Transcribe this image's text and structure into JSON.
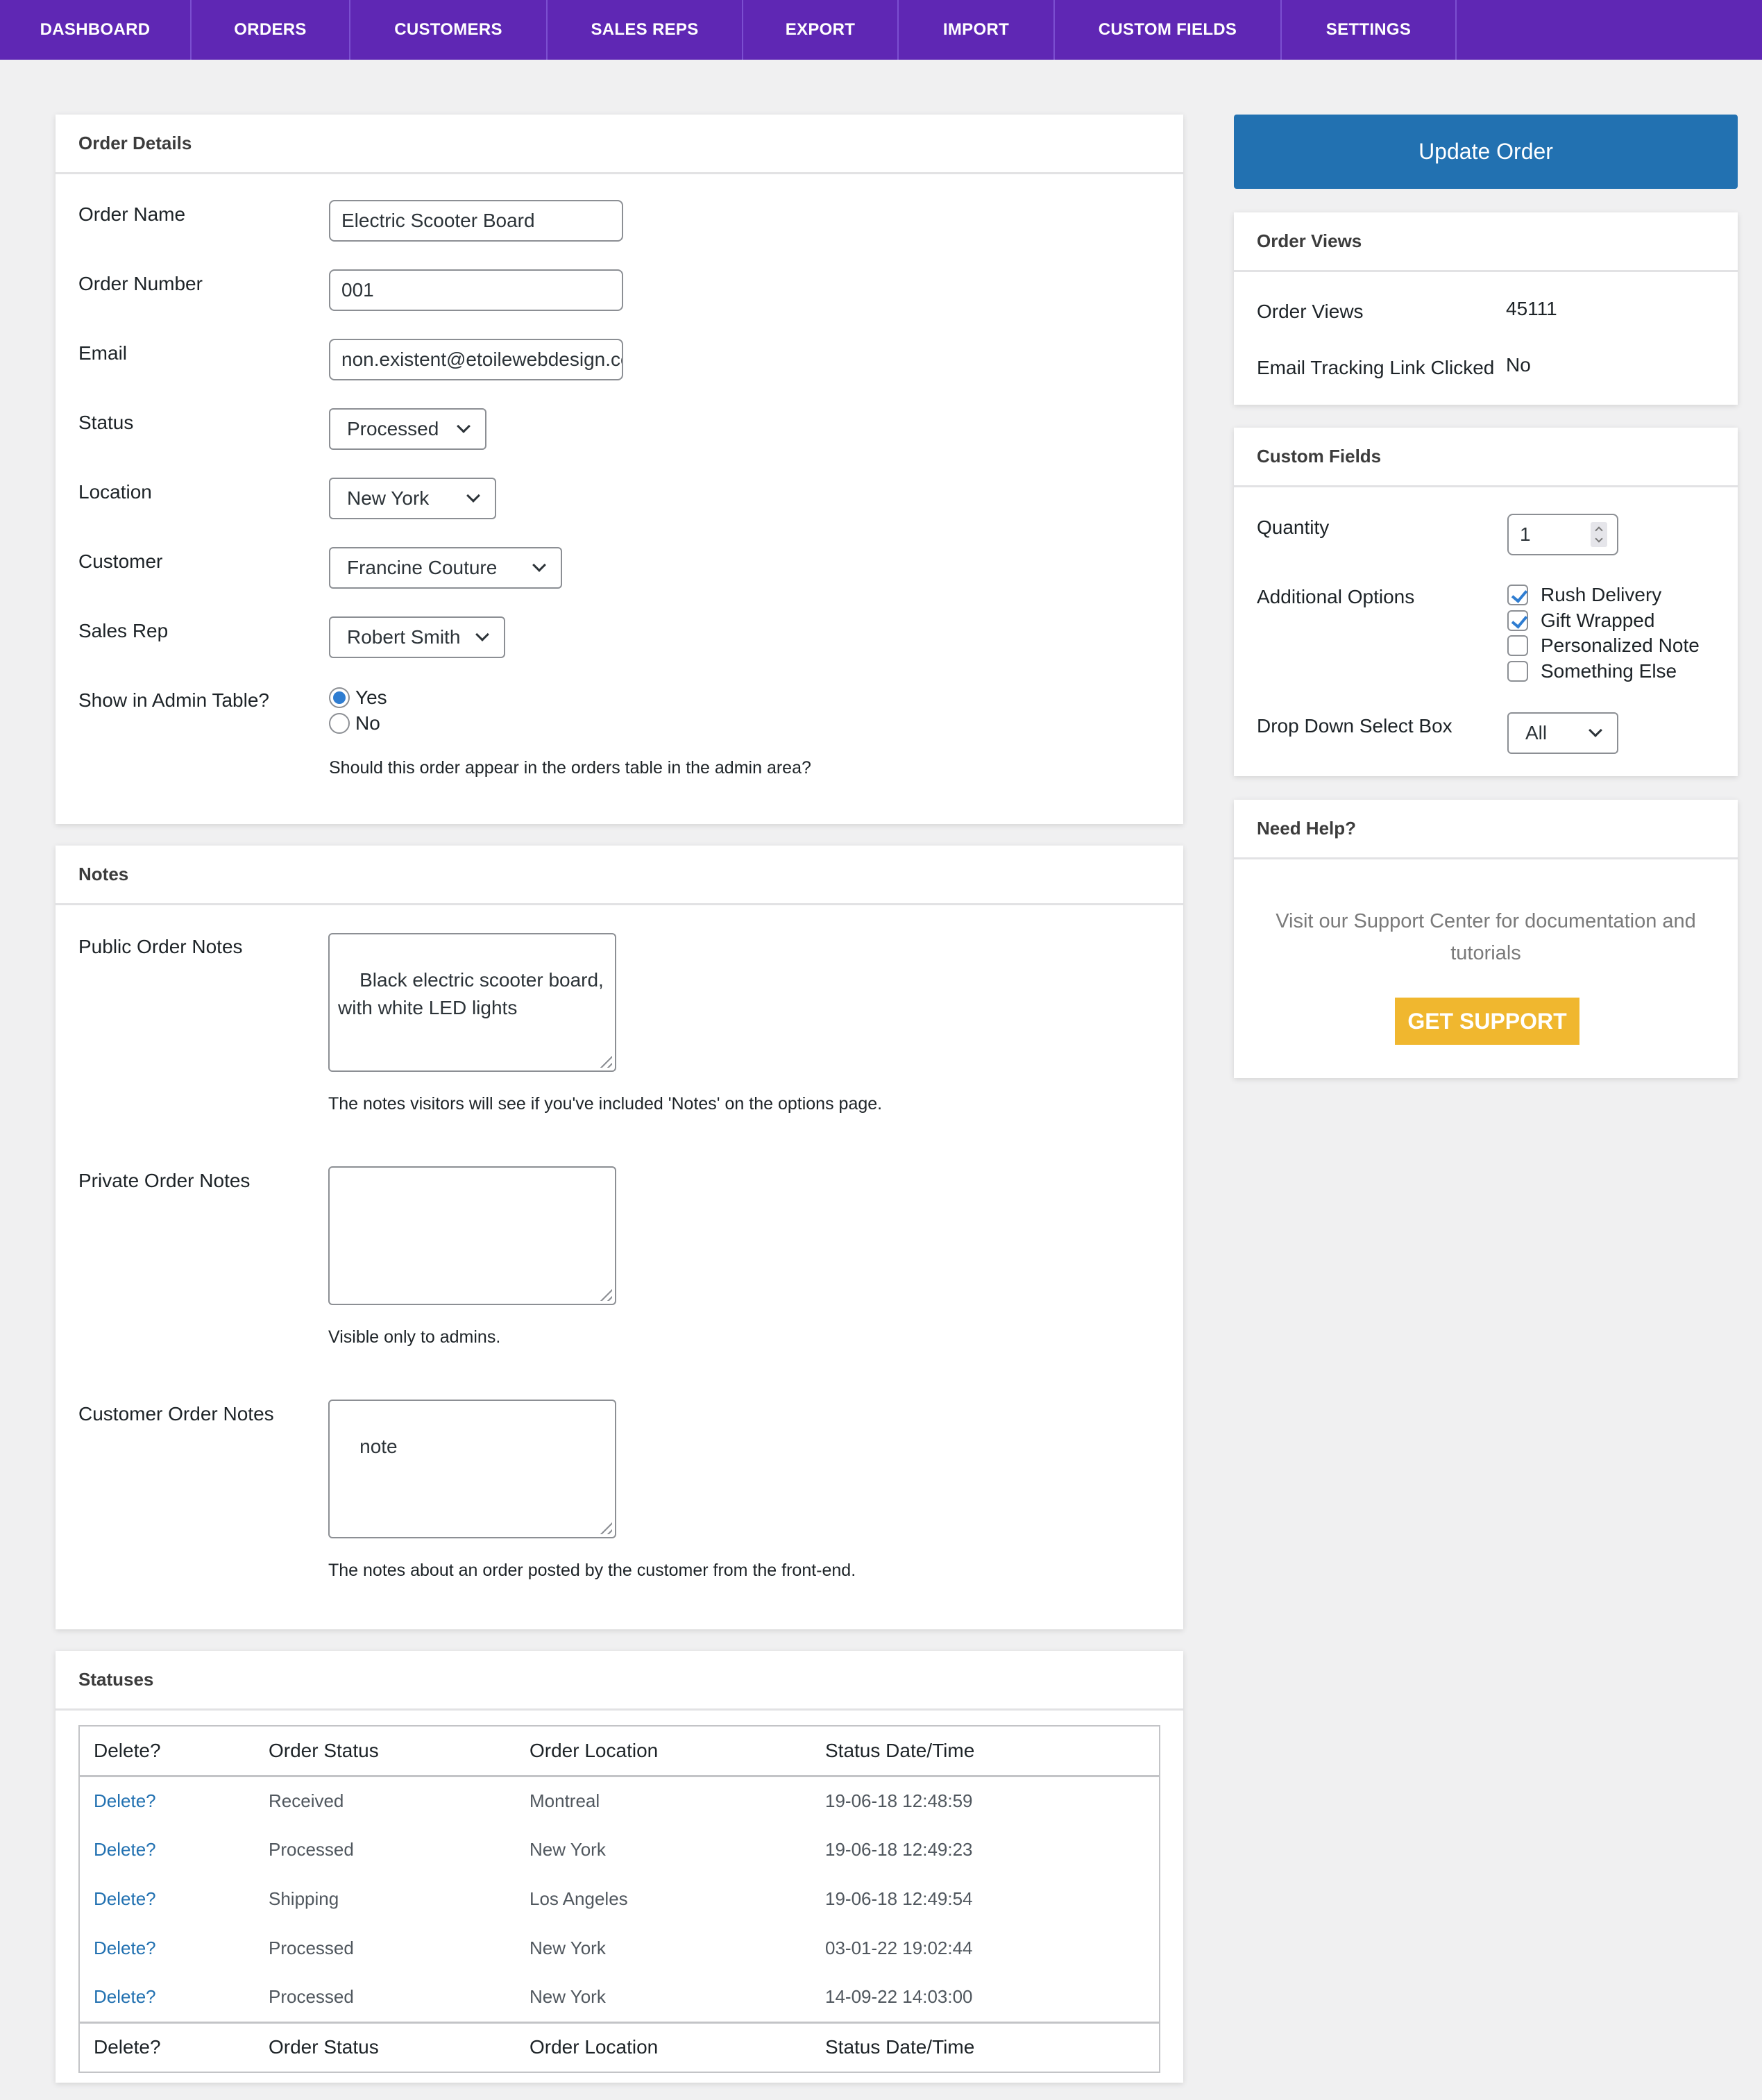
{
  "nav": {
    "items": [
      {
        "label": "DASHBOARD"
      },
      {
        "label": "ORDERS"
      },
      {
        "label": "CUSTOMERS"
      },
      {
        "label": "SALES REPS"
      },
      {
        "label": "EXPORT"
      },
      {
        "label": "IMPORT"
      },
      {
        "label": "CUSTOM FIELDS"
      },
      {
        "label": "SETTINGS"
      }
    ]
  },
  "order_details": {
    "title": "Order Details",
    "order_name": {
      "label": "Order Name",
      "value": "Electric Scooter Board"
    },
    "order_number": {
      "label": "Order Number",
      "value": "001"
    },
    "email": {
      "label": "Email",
      "value": "non.existent@etoilewebdesign.com"
    },
    "status": {
      "label": "Status",
      "value": "Processed"
    },
    "location": {
      "label": "Location",
      "value": "New York"
    },
    "customer": {
      "label": "Customer",
      "value": "Francine Couture"
    },
    "sales_rep": {
      "label": "Sales Rep",
      "value": "Robert Smith"
    },
    "show_in_admin": {
      "label": "Show in Admin Table?",
      "options": [
        {
          "label": "Yes",
          "checked": true
        },
        {
          "label": "No",
          "checked": false
        }
      ],
      "description": "Should this order appear in the orders table in the admin area?"
    }
  },
  "notes": {
    "title": "Notes",
    "public": {
      "label": "Public Order Notes",
      "value": "Black electric scooter board,\nwith white LED lights",
      "description": "The notes visitors will see if you've included 'Notes' on the options page."
    },
    "private": {
      "label": "Private Order Notes",
      "value": "",
      "description": "Visible only to admins."
    },
    "customer": {
      "label": "Customer Order Notes",
      "value": "note",
      "description": "The notes about an order posted by the customer from the front-end."
    }
  },
  "statuses": {
    "title": "Statuses",
    "columns": [
      "Delete?",
      "Order Status",
      "Order Location",
      "Status Date/Time"
    ],
    "rows": [
      {
        "delete": "Delete?",
        "status": "Received",
        "location": "Montreal",
        "datetime": "19-06-18 12:48:59"
      },
      {
        "delete": "Delete?",
        "status": "Processed",
        "location": "New York",
        "datetime": "19-06-18 12:49:23"
      },
      {
        "delete": "Delete?",
        "status": "Shipping",
        "location": "Los Angeles",
        "datetime": "19-06-18 12:49:54"
      },
      {
        "delete": "Delete?",
        "status": "Processed",
        "location": "New York",
        "datetime": "03-01-22 19:02:44"
      },
      {
        "delete": "Delete?",
        "status": "Processed",
        "location": "New York",
        "datetime": "14-09-22 14:03:00"
      }
    ]
  },
  "sidebar": {
    "update_button": "Update Order",
    "order_views": {
      "title": "Order Views",
      "views_label": "Order Views",
      "views_value": "45111",
      "tracking_label": "Email Tracking Link Clicked",
      "tracking_value": "No"
    },
    "custom_fields": {
      "title": "Custom Fields",
      "quantity_label": "Quantity",
      "quantity_value": "1",
      "options_label": "Additional Options",
      "options": [
        {
          "label": "Rush Delivery",
          "checked": true
        },
        {
          "label": "Gift Wrapped",
          "checked": true
        },
        {
          "label": "Personalized Note",
          "checked": false
        },
        {
          "label": "Something Else",
          "checked": false
        }
      ],
      "dropdown_label": "Drop Down Select Box",
      "dropdown_value": "All"
    },
    "help": {
      "title": "Need Help?",
      "text": "Visit our Support Center for documentation and tutorials",
      "button": "GET SUPPORT"
    }
  },
  "colors": {
    "nav_bg": "#5f27b4",
    "primary_button": "#2271b1",
    "support_button": "#f0b72f",
    "link": "#2271b1",
    "check_accent": "#2f7dd1"
  }
}
